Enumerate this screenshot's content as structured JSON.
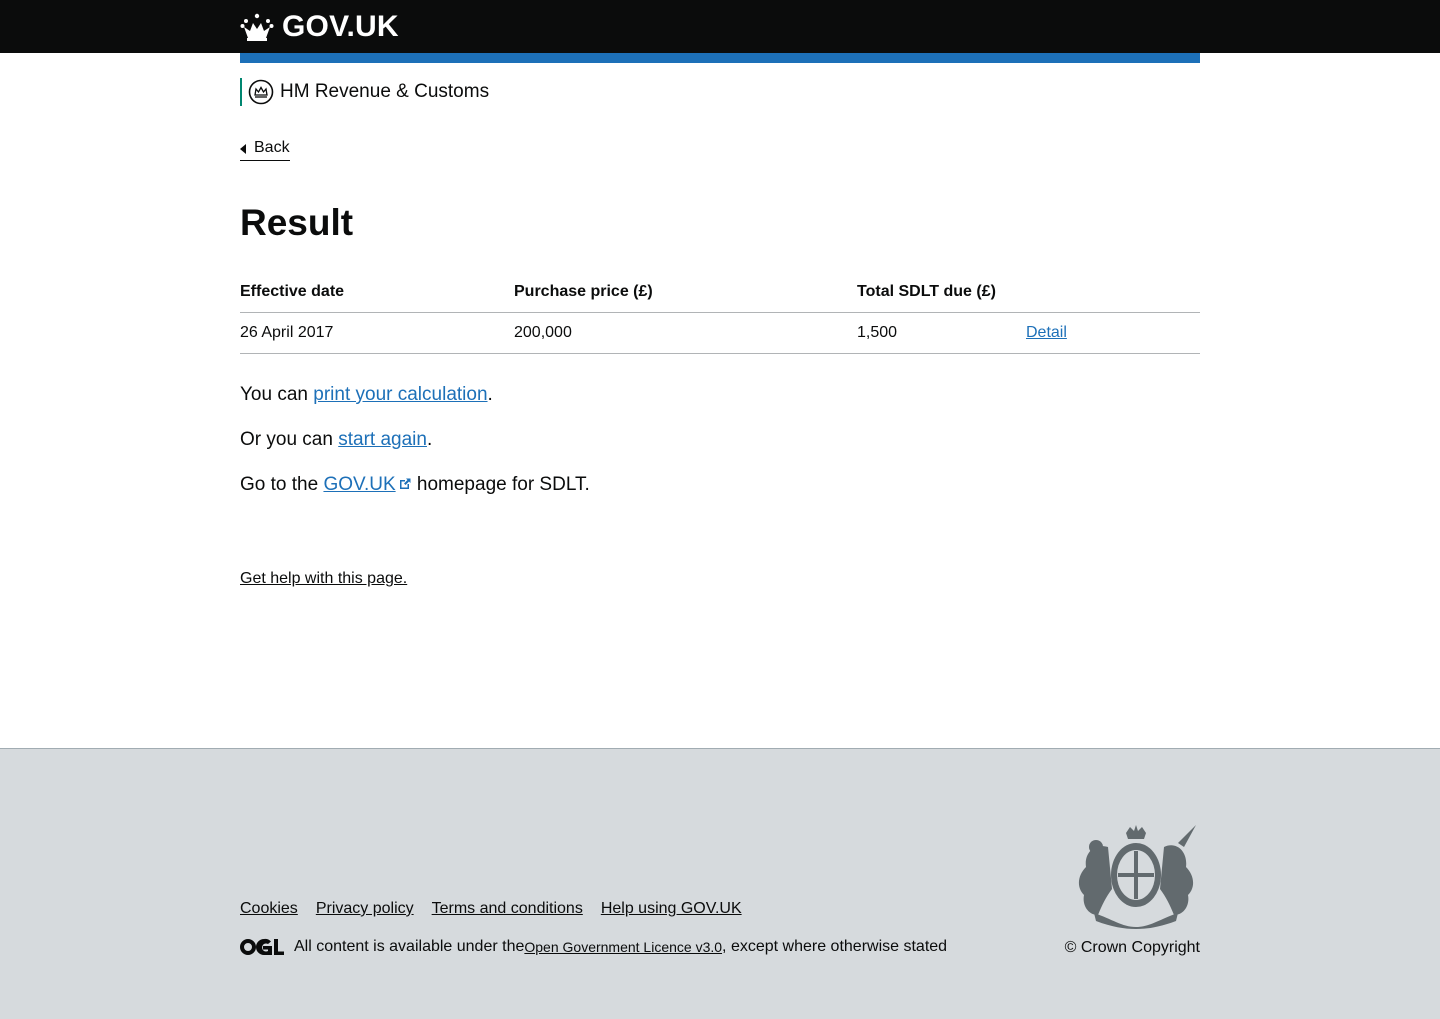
{
  "header": {
    "logo_text": "GOV.UK"
  },
  "organisation": {
    "name": "HM Revenue & Customs"
  },
  "back_link": {
    "label": "Back"
  },
  "page": {
    "title": "Result"
  },
  "table": {
    "headers": [
      "Effective date",
      "Purchase price (£)",
      "Total SDLT due (£)"
    ],
    "rows": [
      {
        "effective_date": "26 April 2017",
        "purchase_price": "200,000",
        "total_sdlt_due": "1,500",
        "detail_link": "Detail"
      }
    ]
  },
  "content": {
    "print_prefix": "You can ",
    "print_link": "print your calculation",
    "print_suffix": ".",
    "start_prefix": "Or you can ",
    "start_link": "start again",
    "start_suffix": ".",
    "govuk_prefix": "Go to the ",
    "govuk_link": "GOV.UK",
    "govuk_suffix": " homepage for SDLT."
  },
  "help": {
    "label": "Get help with this page."
  },
  "footer": {
    "links": [
      "Cookies",
      "Privacy policy",
      "Terms and conditions",
      "Help using GOV.UK"
    ],
    "licence_prefix": "All content is available under the ",
    "licence_link": "Open Government Licence v3.0",
    "licence_suffix": ", except where otherwise stated",
    "copyright": "© Crown Copyright"
  },
  "colors": {
    "header_bg": "#0b0c0c",
    "accent_blue": "#1d70b8",
    "hmrc_green": "#008670",
    "link": "#1d70b8",
    "footer_bg": "#d6dadd"
  },
  "icons": [
    "crown-icon",
    "hmrc-crest-icon",
    "back-chevron-icon",
    "external-link-icon",
    "ogl-logo",
    "royal-coat-of-arms"
  ]
}
